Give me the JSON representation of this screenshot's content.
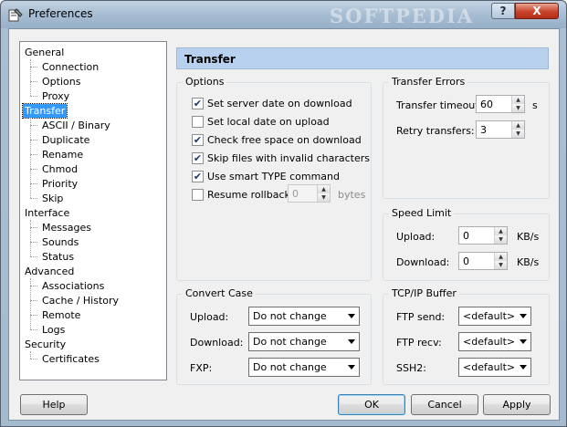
{
  "window": {
    "title": "Preferences",
    "watermark": "SOFTPEDIA",
    "help_glyph": "?",
    "close_glyph": "X"
  },
  "tree": {
    "items": [
      {
        "label": "General",
        "level": 0
      },
      {
        "label": "Connection",
        "level": 1
      },
      {
        "label": "Options",
        "level": 1
      },
      {
        "label": "Proxy",
        "level": 1
      },
      {
        "label": "Transfer",
        "level": 0,
        "selected": true
      },
      {
        "label": "ASCII / Binary",
        "level": 1
      },
      {
        "label": "Duplicate",
        "level": 1
      },
      {
        "label": "Rename",
        "level": 1
      },
      {
        "label": "Chmod",
        "level": 1
      },
      {
        "label": "Priority",
        "level": 1
      },
      {
        "label": "Skip",
        "level": 1
      },
      {
        "label": "Interface",
        "level": 0
      },
      {
        "label": "Messages",
        "level": 1
      },
      {
        "label": "Sounds",
        "level": 1
      },
      {
        "label": "Status",
        "level": 1
      },
      {
        "label": "Advanced",
        "level": 0
      },
      {
        "label": "Associations",
        "level": 1
      },
      {
        "label": "Cache / History",
        "level": 1
      },
      {
        "label": "Remote",
        "level": 1
      },
      {
        "label": "Logs",
        "level": 1
      },
      {
        "label": "Security",
        "level": 0
      },
      {
        "label": "Certificates",
        "level": 1
      }
    ]
  },
  "panel": {
    "title": "Transfer"
  },
  "options": {
    "title": "Options",
    "set_server_date": {
      "label": "Set server date on download",
      "checked": true
    },
    "set_local_date": {
      "label": "Set local date on upload",
      "checked": false
    },
    "check_free_space": {
      "label": "Check free space on download",
      "checked": true
    },
    "skip_invalid": {
      "label": "Skip files with invalid characters",
      "checked": true
    },
    "smart_type": {
      "label": "Use smart TYPE command",
      "checked": true
    },
    "resume_rollback": {
      "label": "Resume rollback:",
      "checked": false,
      "value": "0",
      "unit": "bytes"
    }
  },
  "transfer_errors": {
    "title": "Transfer Errors",
    "timeout_label": "Transfer timeout:",
    "timeout_value": "60",
    "timeout_unit": "s",
    "retry_label": "Retry transfers:",
    "retry_value": "3"
  },
  "speed_limit": {
    "title": "Speed Limit",
    "upload_label": "Upload:",
    "upload_value": "0",
    "upload_unit": "KB/s",
    "download_label": "Download:",
    "download_value": "0",
    "download_unit": "KB/s"
  },
  "convert_case": {
    "title": "Convert Case",
    "upload_label": "Upload:",
    "upload_value": "Do not change",
    "download_label": "Download:",
    "download_value": "Do not change",
    "fxp_label": "FXP:",
    "fxp_value": "Do not change"
  },
  "tcp_buffer": {
    "title": "TCP/IP Buffer",
    "ftp_send_label": "FTP send:",
    "ftp_send_value": "<default>",
    "ftp_recv_label": "FTP recv:",
    "ftp_recv_value": "<default>",
    "ssh2_label": "SSH2:",
    "ssh2_value": "<default>"
  },
  "buttons": {
    "help": "Help",
    "ok": "OK",
    "cancel": "Cancel",
    "apply": "Apply"
  },
  "check_glyph": "✔",
  "spin_up_glyph": "▲",
  "spin_down_glyph": "▼"
}
